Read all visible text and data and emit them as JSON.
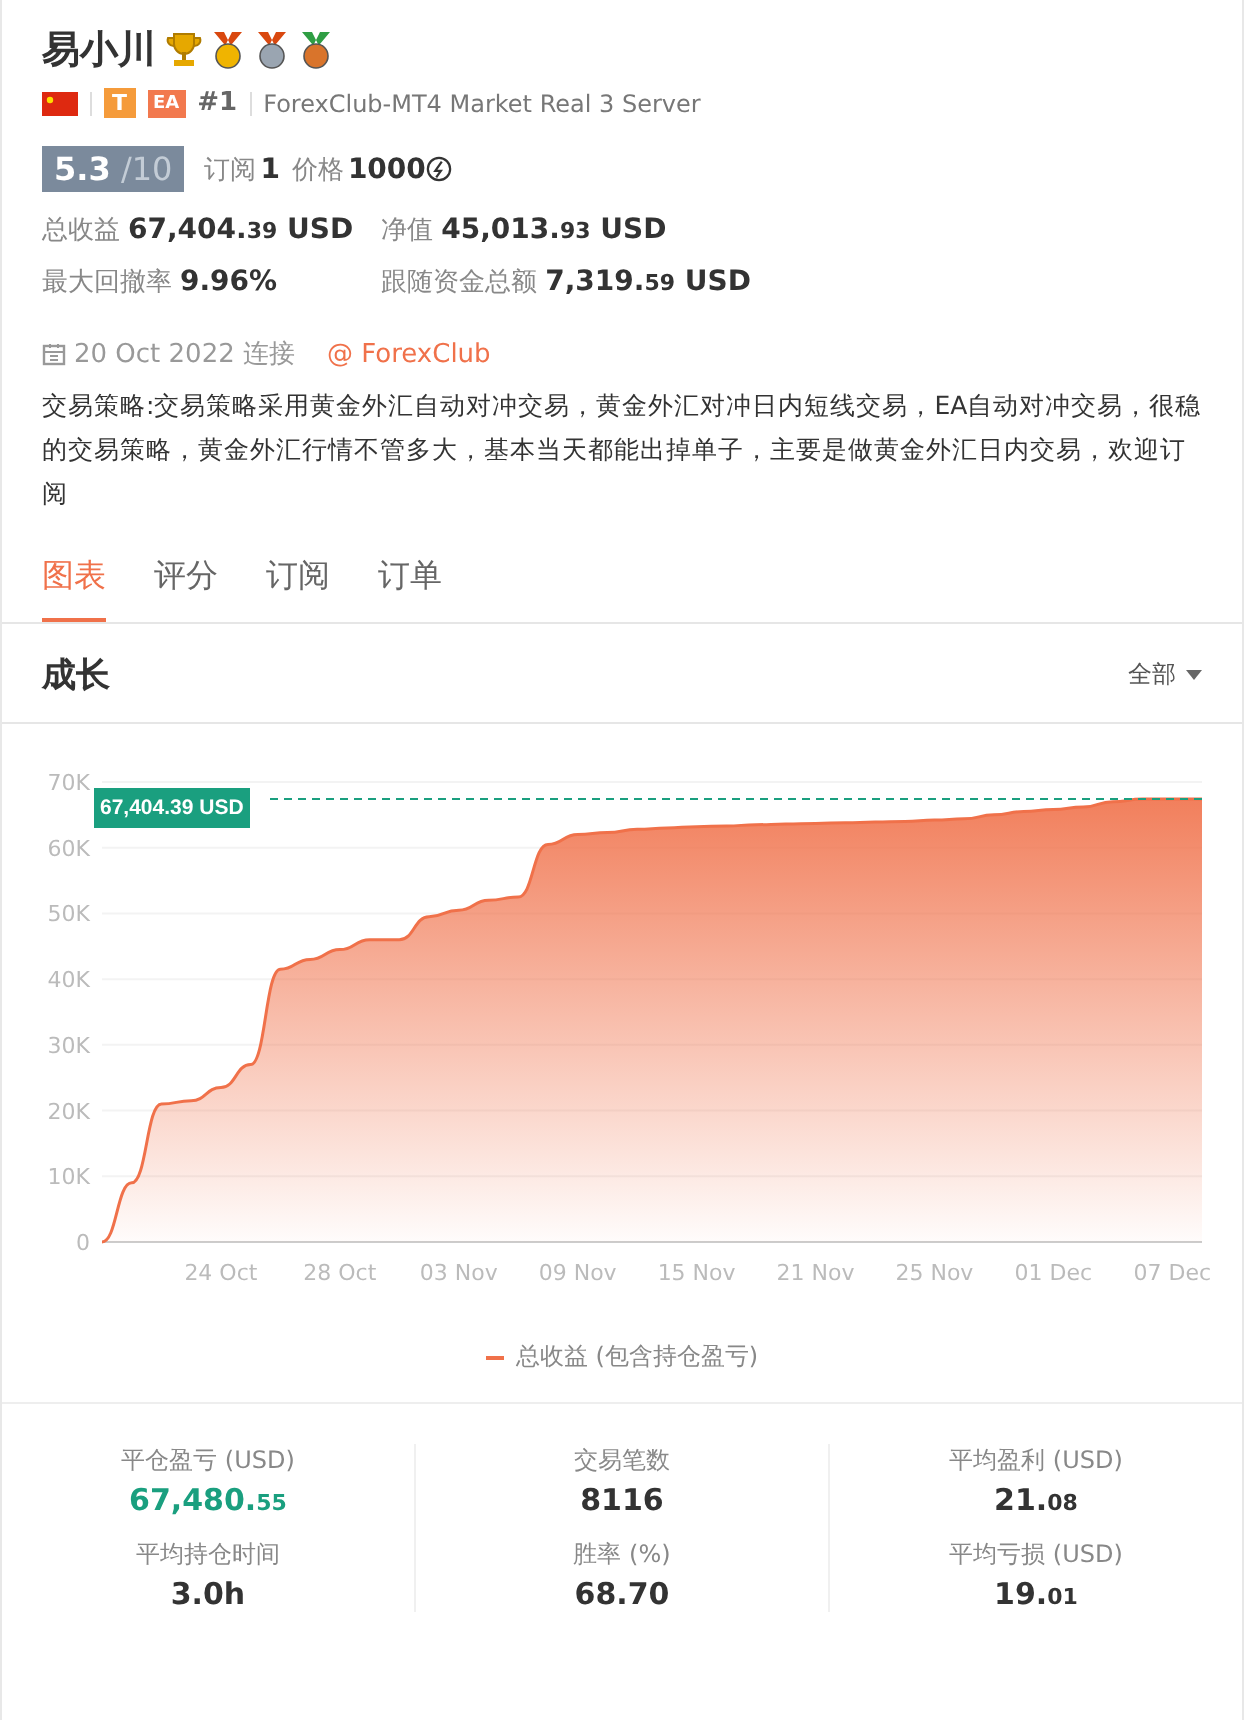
{
  "profile": {
    "name": "易小川",
    "tags": [
      "T",
      "EA"
    ],
    "rank": "#1",
    "server": "ForexClub-MT4 Market Real 3 Server"
  },
  "rating": {
    "score": "5.3",
    "scale": "/10"
  },
  "subscriptions": {
    "label": "订阅",
    "value": "1"
  },
  "price": {
    "label": "价格",
    "value": "1000"
  },
  "metrics": [
    {
      "label": "总收益",
      "value": "67,404.",
      "decimals": "39",
      "unit": "USD"
    },
    {
      "label": "净值",
      "value": "45,013.",
      "decimals": "93",
      "unit": "USD"
    },
    {
      "label": "最大回撤率",
      "value": "9.96%"
    },
    {
      "label": "跟随资金总额",
      "value": "7,319.",
      "decimals": "59",
      "unit": "USD"
    }
  ],
  "connected": {
    "date": "20 Oct 2022 连接",
    "broker": "@ ForexClub"
  },
  "description": "交易策略:交易策略采用黄金外汇自动对冲交易，黄金外汇对冲日内短线交易，EA自动对冲交易，很稳的交易策略，黄金外汇行情不管多大，基本当天都能出掉单子，主要是做黄金外汇日内交易，欢迎订阅",
  "tabs": [
    {
      "label": "图表",
      "selected": true
    },
    {
      "label": "评分",
      "selected": false
    },
    {
      "label": "订阅",
      "selected": false
    },
    {
      "label": "订单",
      "selected": false
    }
  ],
  "section": {
    "title": "成长",
    "filter": "全部"
  },
  "chart_data": {
    "type": "area",
    "categories": [
      null,
      null,
      null,
      null,
      "24 Oct",
      null,
      null,
      null,
      "28 Oct",
      null,
      null,
      null,
      "03 Nov",
      null,
      null,
      null,
      "09 Nov",
      null,
      null,
      null,
      "15 Nov",
      null,
      null,
      null,
      "21 Nov",
      null,
      null,
      null,
      "25 Nov",
      null,
      null,
      null,
      "01 Dec",
      null,
      null,
      null,
      "07 Dec",
      null
    ],
    "series": [
      {
        "name": "总收益 (包含持仓盈亏)",
        "color": "#f0714a",
        "values": [
          0,
          9000,
          21000,
          21500,
          23500,
          27000,
          41500,
          43000,
          44500,
          46000,
          46000,
          49500,
          50500,
          52000,
          52500,
          60500,
          62000,
          62300,
          62800,
          63000,
          63200,
          63300,
          63500,
          63600,
          63700,
          63800,
          63900,
          64000,
          64200,
          64400,
          65000,
          65500,
          65800,
          66200,
          67000,
          67400,
          67400,
          67400
        ]
      }
    ],
    "ylim": [
      0,
      70000
    ],
    "yticks": [
      {
        "value": 0,
        "label": "0"
      },
      {
        "value": 10000,
        "label": "10K"
      },
      {
        "value": 20000,
        "label": "20K"
      },
      {
        "value": 30000,
        "label": "30K"
      },
      {
        "value": 40000,
        "label": "40K"
      },
      {
        "value": 50000,
        "label": "50K"
      },
      {
        "value": 60000,
        "label": "60K"
      },
      {
        "value": 70000,
        "label": "70K"
      }
    ],
    "grid": true,
    "ref_lines": [
      {
        "axis": "y",
        "value": 67404.39,
        "label": "67,404.39 USD",
        "color": "#1a9f7f"
      }
    ]
  },
  "stats": [
    {
      "label": "平仓盈亏 (USD)",
      "value": "67,480.",
      "decimals": "55",
      "kind": "profit"
    },
    {
      "label": "平均持仓时间",
      "value": "3.0h",
      "kind": "plain"
    },
    {
      "label": "交易笔数",
      "value": "8116",
      "kind": "plain"
    },
    {
      "label": "胜率 (%)",
      "value": "68.70",
      "kind": "plain"
    },
    {
      "label": "平均盈利 (USD)",
      "value": "21.",
      "decimals": "08",
      "kind": "plain"
    },
    {
      "label": "平均亏损 (USD)",
      "value": "19.",
      "decimals": "01",
      "kind": "plain"
    }
  ]
}
